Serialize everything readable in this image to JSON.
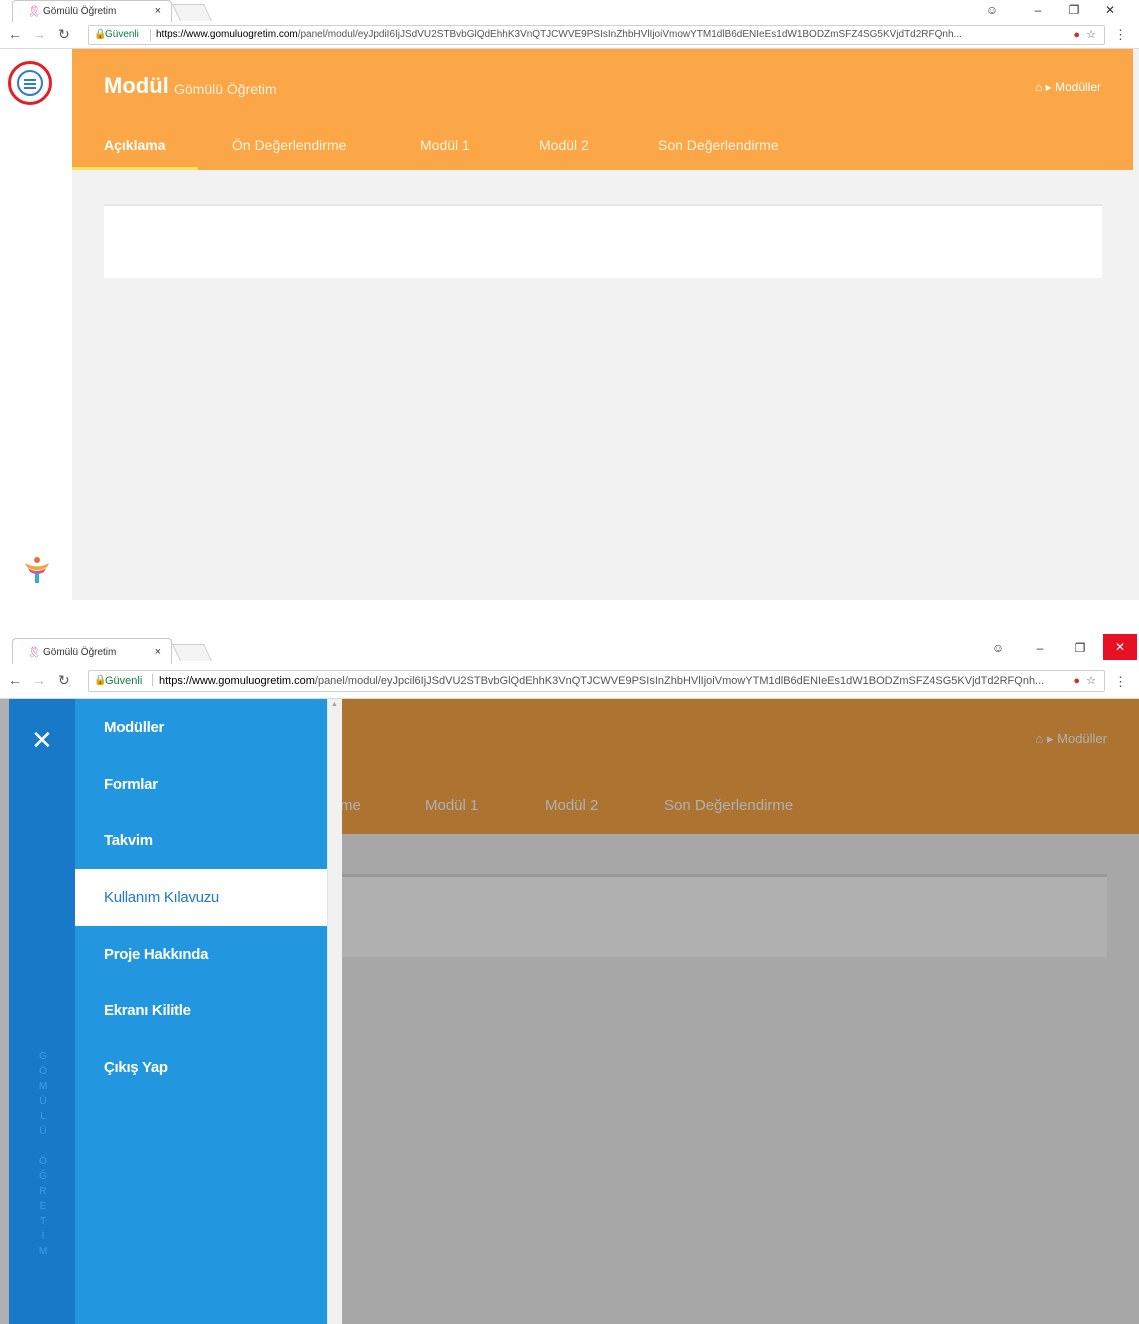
{
  "browser": {
    "tab_title": "Gömülü Öğretim",
    "tab_close": "×",
    "favicon": "🎗",
    "secure_label": "Güvenli",
    "url_host": "https://www.gomuluogretim.com",
    "url_path": "/panel/modul/eyJpdiI6IjJSdVU2STBvbGlQdEhhK3VnQTJCWVE9PSIsInZhbHVlIjoiVmowYTM1dlB6dENIeEs1dW1BODZmSFZ4SG5KVjdTd2RFQnh...",
    "url_host_2": "https://www.gomuluogretim.com",
    "url_path_2": "/panel/modul/eyJpcil6IjJSdVU2STBvbGlQdEhhK3VnQTJCWVE9PSIsInZhbHVlIjoiVmowYTM1dlB6dENIeEs1dW1BODZmSFZ4SG5KVjdTd2RFQnh..."
  },
  "header": {
    "title": "Modül",
    "subtitle": "Gömülü Öğretim",
    "breadcrumb": "Modüller",
    "tabs": [
      {
        "label": "Açıklama"
      },
      {
        "label": "Ön Değerlendirme"
      },
      {
        "label": "Modül 1"
      },
      {
        "label": "Modül 2"
      },
      {
        "label": "Son Değerlendirme"
      }
    ],
    "partial_tab": "me"
  },
  "sidebar": {
    "vertical_letters": [
      "G",
      "Ö",
      "M",
      "Ü",
      "L",
      "Ü",
      "",
      "Ö",
      "Ğ",
      "R",
      "E",
      "T",
      "İ",
      "M"
    ],
    "items": [
      {
        "label": "Modüller"
      },
      {
        "label": "Formlar"
      },
      {
        "label": "Takvim"
      },
      {
        "label": "Kullanım Kılavuzu"
      },
      {
        "label": "Proje Hakkında"
      },
      {
        "label": "Ekranı Kilitle"
      },
      {
        "label": "Çıkış Yap"
      }
    ],
    "selected_index": 3
  },
  "colors": {
    "header_orange": "#fba747",
    "sidebar_blue": "#2396e0",
    "sidebar_dark_blue": "#1779c7",
    "highlight_red": "#e41e26"
  }
}
